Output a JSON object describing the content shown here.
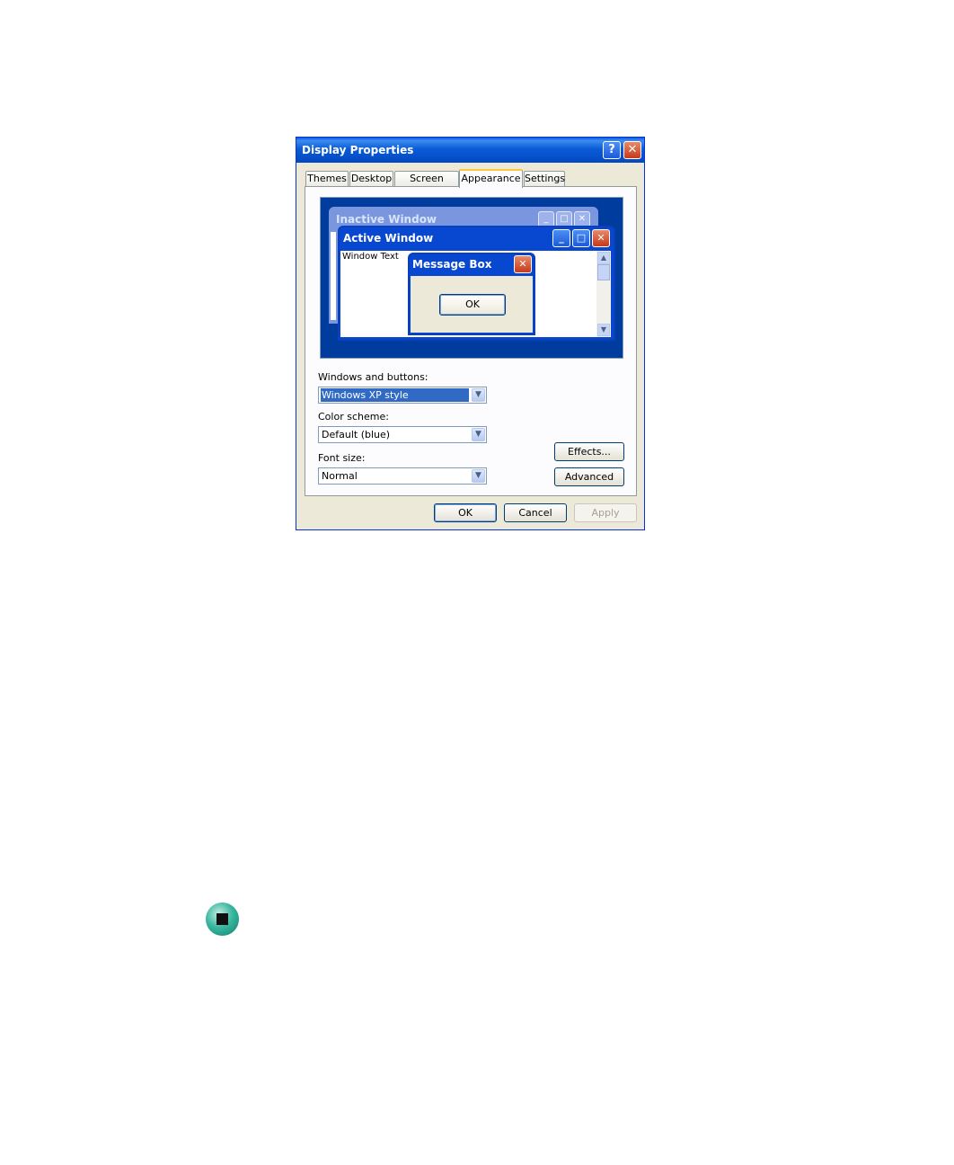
{
  "dialog": {
    "title": "Display Properties",
    "help_glyph": "?",
    "close_glyph": "✕",
    "tabs": [
      {
        "label": "Themes"
      },
      {
        "label": "Desktop"
      },
      {
        "label": "Screen Saver"
      },
      {
        "label": "Appearance",
        "selected": true
      },
      {
        "label": "Settings"
      }
    ],
    "preview": {
      "inactive_title": "Inactive Window",
      "active_title": "Active Window",
      "window_text": "Window Text",
      "message_box_title": "Message Box",
      "message_box_ok": "OK"
    },
    "windows_and_buttons": {
      "label": "Windows and buttons:",
      "value": "Windows XP style"
    },
    "color_scheme": {
      "label": "Color scheme:",
      "value": "Default (blue)"
    },
    "font_size": {
      "label": "Font size:",
      "value": "Normal"
    },
    "effects_label": "Effects...",
    "advanced_label": "Advanced",
    "ok_label": "OK",
    "cancel_label": "Cancel",
    "apply_label": "Apply"
  },
  "colors": {
    "title_bar": "#0a5cd6",
    "preview_bg": "#003c9d",
    "dialog_bg": "#ece9d8",
    "selection": "#316ac5",
    "tab_highlight": "#ffc83c"
  }
}
